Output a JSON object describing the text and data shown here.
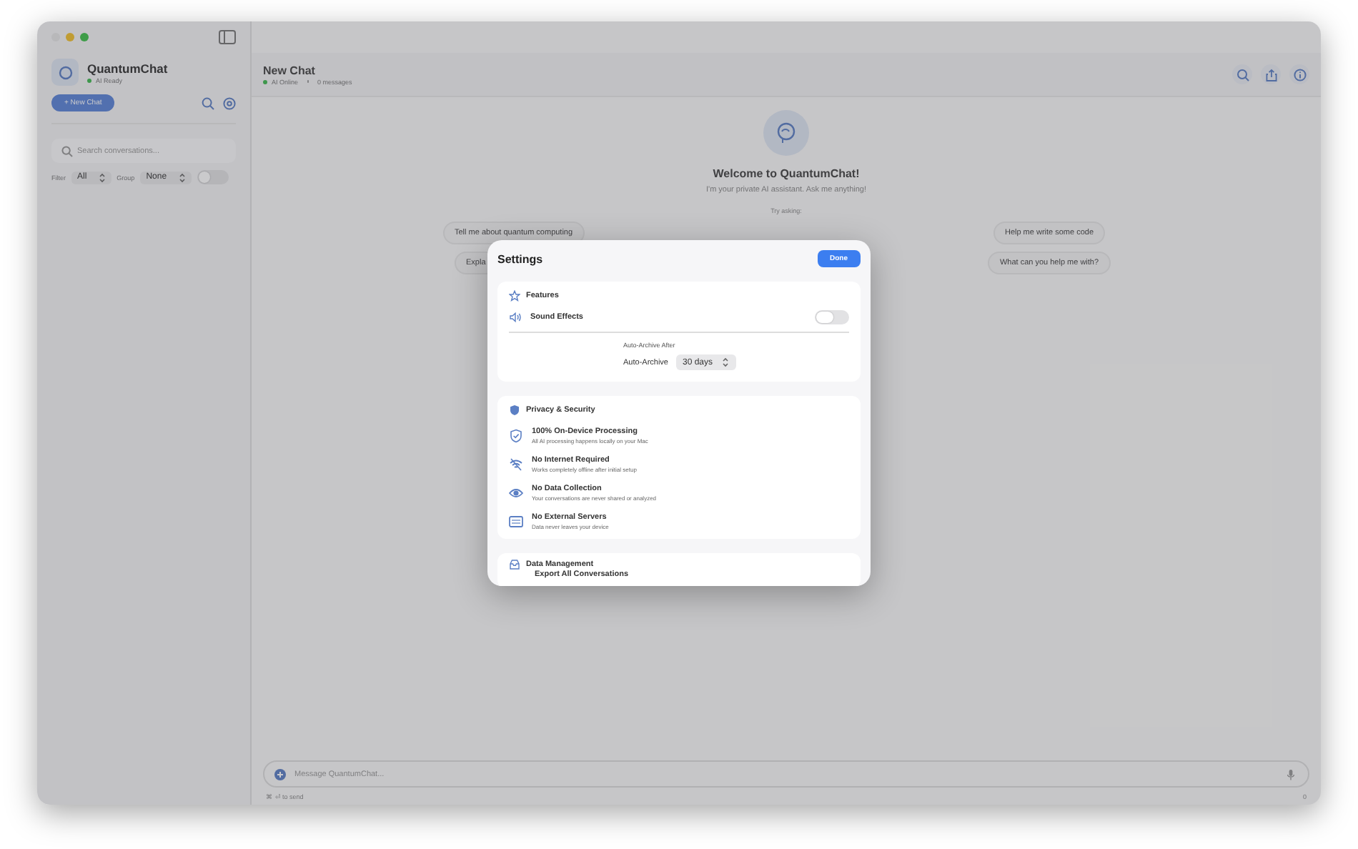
{
  "sidebar": {
    "app_name": "QuantumChat",
    "status": "AI Ready",
    "new_chat": "+ New Chat",
    "search": {
      "placeholder": "Search conversations..."
    },
    "filter": {
      "label": "Filter",
      "value": "All"
    },
    "group": {
      "label": "Group",
      "value": "None"
    },
    "toggle": {
      "on": false
    }
  },
  "header": {
    "title": "New Chat",
    "status": "AI Online",
    "messages": "0 messages"
  },
  "welcome": {
    "title": "Welcome to QuantumChat!",
    "subtitle": "I'm your private AI assistant. Ask me anything!",
    "try": "Try asking:"
  },
  "suggestions": [
    {
      "text": "Tell me about quantum computing"
    },
    {
      "text": "Help me write some code"
    },
    {
      "text": "Expla"
    },
    {
      "text": "What can you help me with?"
    }
  ],
  "composer": {
    "placeholder": "Message QuantumChat...",
    "hint": "⌘ ⏎ to send",
    "count": "0"
  },
  "settings": {
    "title": "Settings",
    "done": "Done",
    "features": {
      "title": "Features",
      "sound_effects": {
        "label": "Sound Effects",
        "on": false
      },
      "archive_caption": "Auto-Archive After",
      "archive_label": "Auto-Archive",
      "archive_value": "30 days"
    },
    "privacy": {
      "title": "Privacy & Security",
      "items": [
        {
          "kind": "shield",
          "title": "100% On-Device Processing",
          "desc": "All AI processing happens locally on your Mac"
        },
        {
          "kind": "wifi",
          "title": "No Internet Required",
          "desc": "Works completely offline after initial setup"
        },
        {
          "kind": "eye",
          "title": "No Data Collection",
          "desc": "Your conversations are never shared or analyzed"
        },
        {
          "kind": "server",
          "title": "No External Servers",
          "desc": "Data never leaves your device"
        }
      ]
    },
    "data": {
      "title": "Data Management",
      "first_item": "Export All Conversations"
    }
  }
}
